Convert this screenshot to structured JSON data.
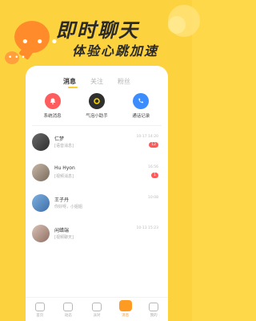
{
  "promo": {
    "headline": "即时聊天",
    "subheadline": "体验心跳加速",
    "bubble_dots": "• • •",
    "bubble_small_dots": "• • •"
  },
  "tabs": [
    {
      "label": "消息",
      "active": true
    },
    {
      "label": "关注",
      "active": false
    },
    {
      "label": "粉丝",
      "active": false
    }
  ],
  "quick_actions": [
    {
      "label": "系统消息",
      "icon": "bell-icon",
      "color": "#ff5d5d"
    },
    {
      "label": "气泡小助手",
      "icon": "bubble-helper-icon",
      "color": "#2f2f2f"
    },
    {
      "label": "通话记录",
      "icon": "phone-icon",
      "color": "#3b8cff"
    }
  ],
  "messages": [
    {
      "name": "仁梦",
      "preview": "[语音消息]",
      "time": "10-17 14:20",
      "badge": "12"
    },
    {
      "name": "Hu Hyon",
      "preview": "[视频消息]",
      "time": "16:56",
      "badge": "1"
    },
    {
      "name": "王子丹",
      "preview": "你好呀，小姐姐",
      "time": "10:08",
      "badge": ""
    },
    {
      "name": "闲蜡端",
      "preview": "[视频聊天]",
      "time": "10-13 15:23",
      "badge": ""
    }
  ],
  "bottom_nav": [
    {
      "label": "首页",
      "active": false
    },
    {
      "label": "动态",
      "active": false
    },
    {
      "label": "派对",
      "active": false
    },
    {
      "label": "消息",
      "active": true
    },
    {
      "label": "我的",
      "active": false
    }
  ]
}
